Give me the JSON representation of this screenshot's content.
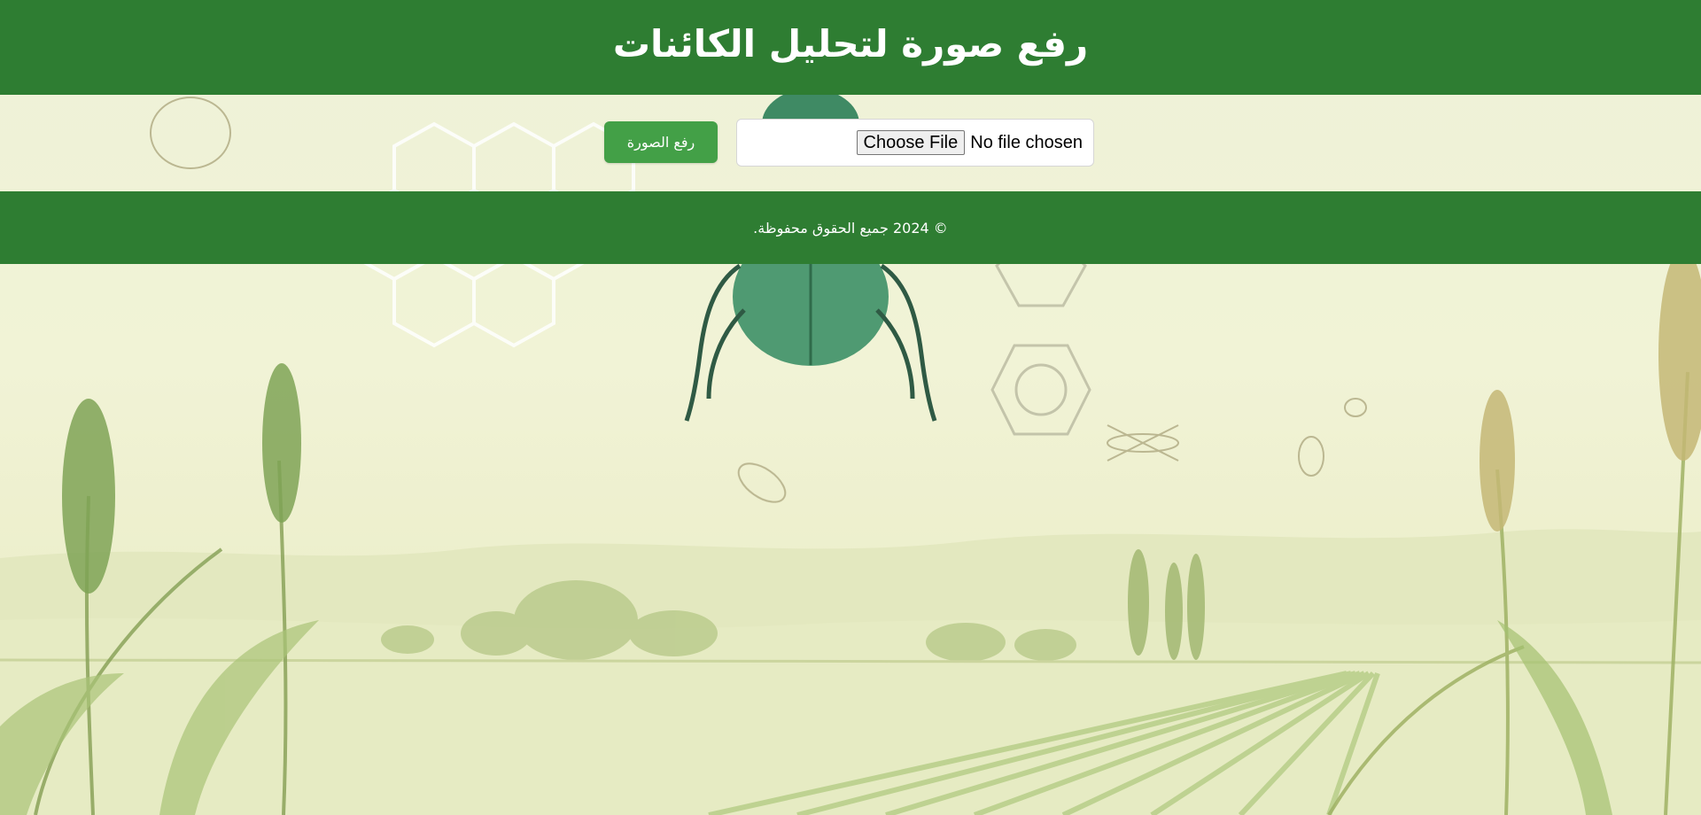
{
  "header": {
    "title": "رفع صورة لتحليل الكائنات"
  },
  "upload_form": {
    "choose_file_label": "Choose File",
    "file_status": "No file chosen",
    "upload_button_label": "رفع الصورة"
  },
  "footer": {
    "copyright": "© 2024 جميع الحقوق محفوظة."
  },
  "colors": {
    "header_bg": "#2e7d32",
    "button_bg": "#43a047",
    "footer_bg": "#2e7d32"
  }
}
